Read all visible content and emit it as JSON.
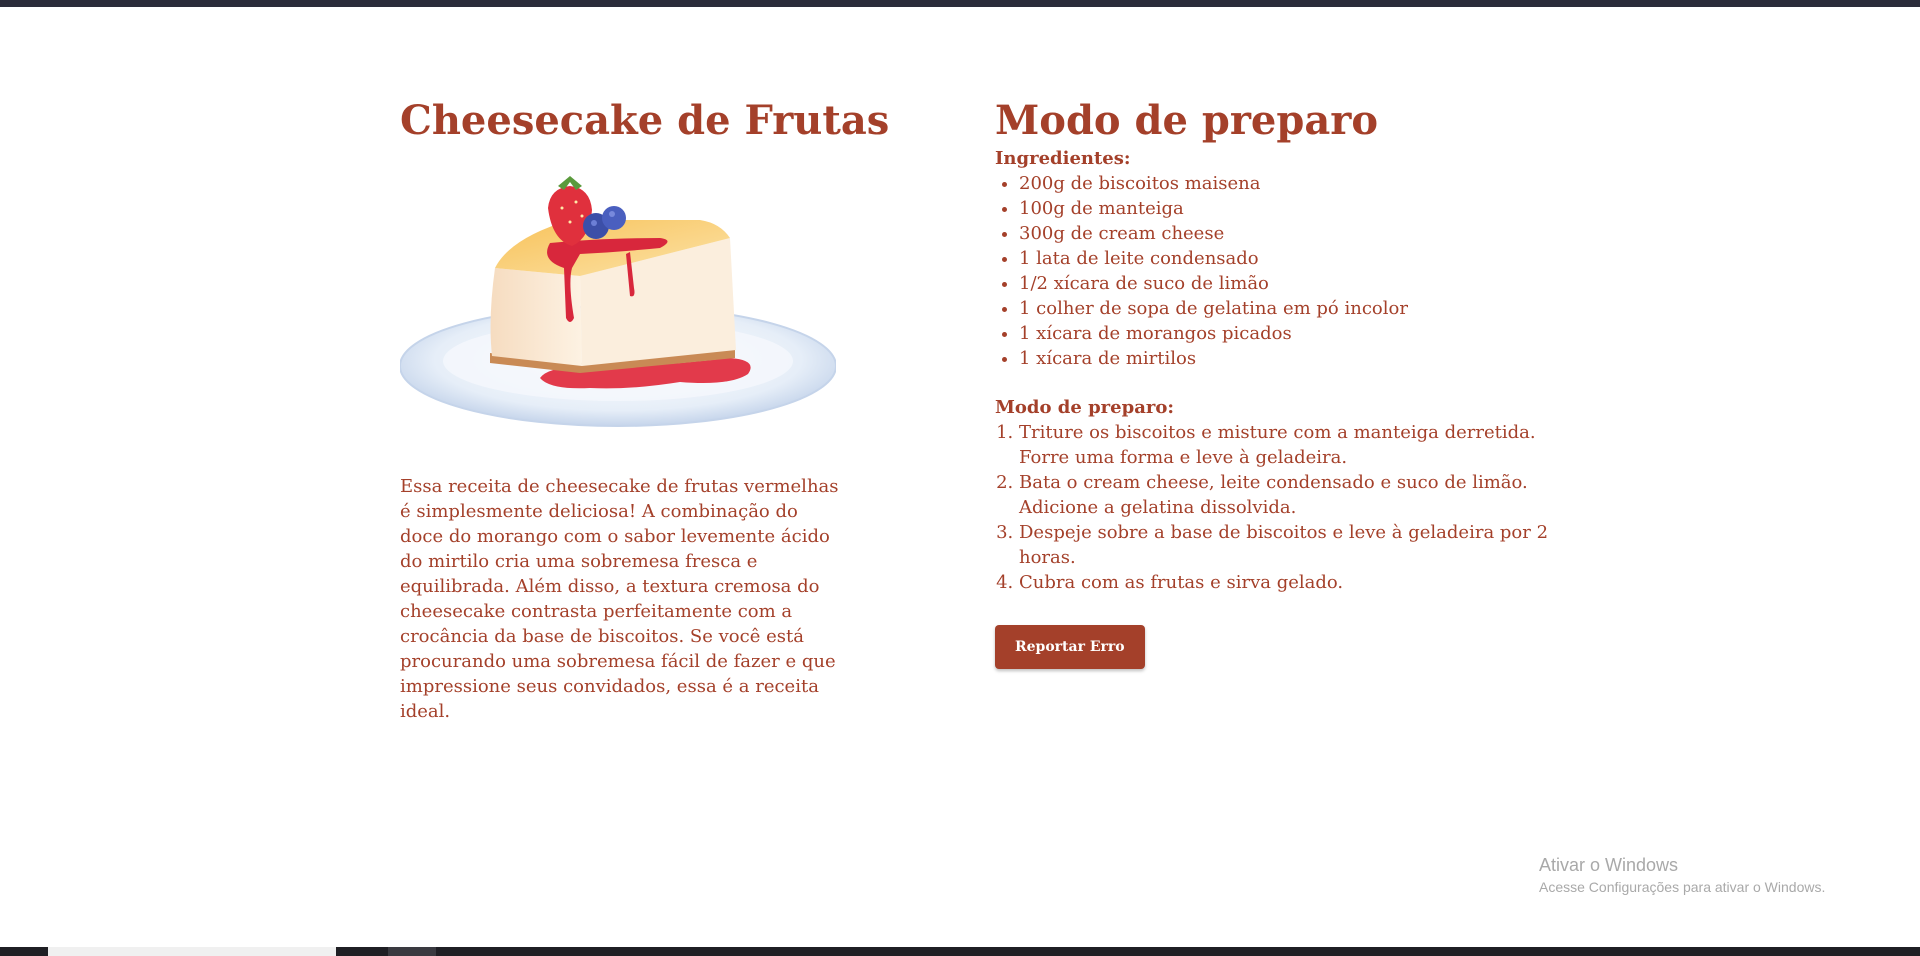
{
  "recipe": {
    "title": "Cheesecake de Frutas",
    "description": "Essa receita de cheesecake de frutas vermelhas é simplesmente deliciosa! A combinação do doce do morango com o sabor levemente ácido do mirtilo cria uma sobremesa fresca e equilibrada. Além disso, a textura cremosa do cheesecake contrasta perfeitamente com a crocância da base de biscoitos. Se você está procurando uma sobremesa fácil de fazer e que impressione seus convidados, essa é a receita ideal.",
    "image_icon": "cheesecake-illustration"
  },
  "prep": {
    "title": "Modo de preparo",
    "ingredients_heading": "Ingredientes:",
    "ingredients": [
      "200g de biscoitos maisena",
      "100g de manteiga",
      "300g de cream cheese",
      "1 lata de leite condensado",
      "1/2 xícara de suco de limão",
      "1 colher de sopa de gelatina em pó incolor",
      "1 xícara de morangos picados",
      "1 xícara de mirtilos"
    ],
    "steps_heading": "Modo de preparo:",
    "steps": [
      "Triture os biscoitos e misture com a manteiga derretida. Forre uma forma e leve à geladeira.",
      "Bata o cream cheese, leite condensado e suco de limão. Adicione a gelatina dissolvida.",
      "Despeje sobre a base de biscoitos e leve à geladeira por 2 horas.",
      "Cubra com as frutas e sirva gelado."
    ],
    "report_button": "Reportar Erro"
  },
  "watermark": {
    "title": "Ativar o Windows",
    "subtitle": "Acesse Configurações para ativar o Windows."
  },
  "colors": {
    "accent": "#a4402a",
    "background": "#ffffff",
    "top_bar": "#2b2c3a"
  }
}
